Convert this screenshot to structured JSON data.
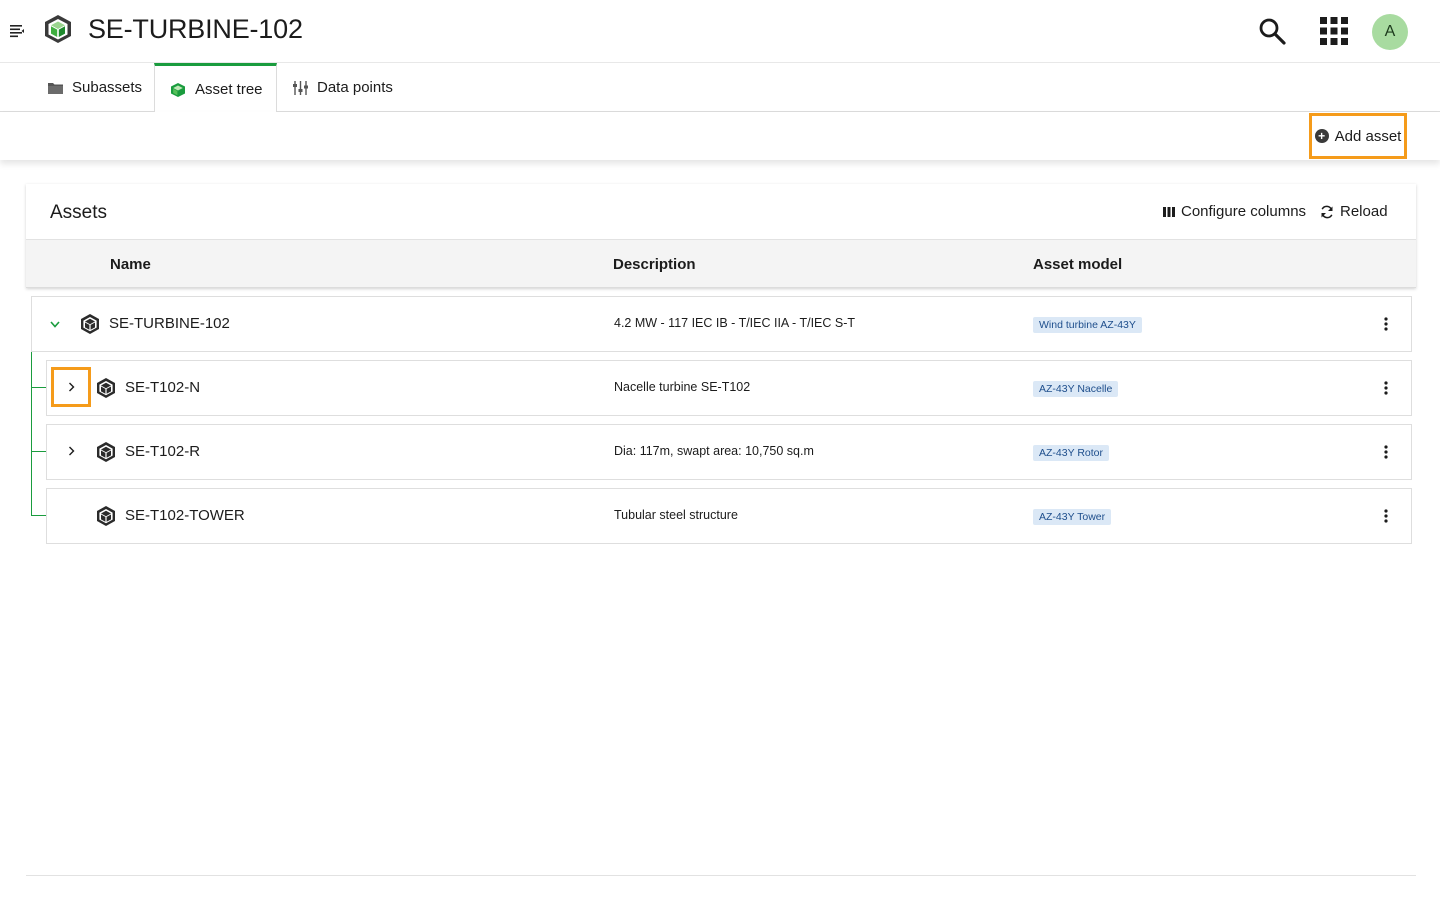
{
  "header": {
    "title": "SE-TURBINE-102",
    "avatar_initial": "A",
    "menu_icon": "menu-collapse-icon",
    "logo_icon": "asset-cube-icon",
    "search_icon": "search-icon",
    "apps_icon": "app-grid-icon"
  },
  "tabs": [
    {
      "label": "Subassets",
      "icon": "folder-icon",
      "active": false
    },
    {
      "label": "Asset tree",
      "icon": "cube-icon",
      "active": true
    },
    {
      "label": "Data points",
      "icon": "sliders-icon",
      "active": false
    }
  ],
  "actions": {
    "add_asset": "Add asset"
  },
  "assets_card": {
    "title": "Assets",
    "configure_columns": "Configure columns",
    "reload": "Reload",
    "columns": [
      "Name",
      "Description",
      "Asset model"
    ]
  },
  "rows": [
    {
      "name": "SE-TURBINE-102",
      "description": "4.2 MW - 117 IEC IB - T/IEC IIA - T/IEC S-T",
      "model": "Wind turbine AZ-43Y",
      "expanded": true
    },
    {
      "name": "SE-T102-N",
      "description": "Nacelle turbine SE-T102",
      "model": "AZ-43Y Nacelle",
      "expanded": false
    },
    {
      "name": "SE-T102-R",
      "description": "Dia: 117m, swapt area: 10,750 sq.m",
      "model": "AZ-43Y Rotor",
      "expanded": false
    },
    {
      "name": "SE-T102-TOWER",
      "description": "Tubular steel structure",
      "model": "AZ-43Y Tower",
      "expanded": false
    }
  ],
  "colors": {
    "accent_green": "#1a9c3e",
    "highlight_orange": "#f59b1a",
    "badge_bg": "#dbe8f6",
    "badge_text": "#1e4e8c",
    "avatar_bg": "#a8dba0"
  }
}
